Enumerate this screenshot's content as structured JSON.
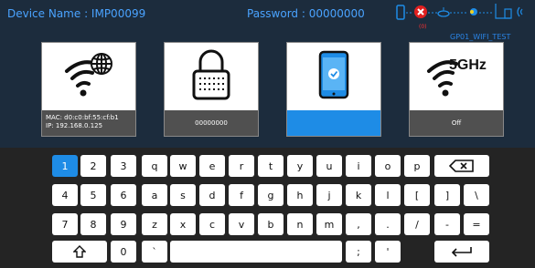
{
  "header": {
    "device_name": "Device Name : IMP00099",
    "password": "Password : 00000000",
    "error_count": "(0)",
    "device_id": "GP01_WIFI_TEST"
  },
  "tiles": [
    {
      "name": "wifi-info",
      "icon": "wifi-globe-icon",
      "mac": "MAC:  d0:c0:bf:55:cf:b1",
      "ip": "IP:    192.168.0.125"
    },
    {
      "name": "password",
      "icon": "lock-icon",
      "label": "00000000"
    },
    {
      "name": "phone",
      "icon": "phone-check-icon",
      "label": ""
    },
    {
      "name": "band",
      "icon": "wifi-5ghz-icon",
      "badge": "5GHz",
      "label": "Off"
    }
  ],
  "keyboard": {
    "row1": [
      "1",
      "2",
      "3",
      "q",
      "w",
      "e",
      "r",
      "t",
      "y",
      "u",
      "i",
      "o",
      "p"
    ],
    "row2": [
      "4",
      "5",
      "6",
      "a",
      "s",
      "d",
      "f",
      "g",
      "h",
      "j",
      "k",
      "l",
      "[",
      "]",
      "\\"
    ],
    "row3": [
      "7",
      "8",
      "9",
      "z",
      "x",
      "c",
      "v",
      "b",
      "n",
      "m",
      ",",
      ".",
      "/",
      "-",
      "="
    ],
    "row4_zero": "0",
    "row4_backtick": "`",
    "row4_semicolon": ";",
    "row4_quote": "'"
  },
  "colors": {
    "accent": "#1e8ce6",
    "header_text": "#4aa3ff",
    "header_bg": "#1c2c3d",
    "error": "#ff3030"
  }
}
